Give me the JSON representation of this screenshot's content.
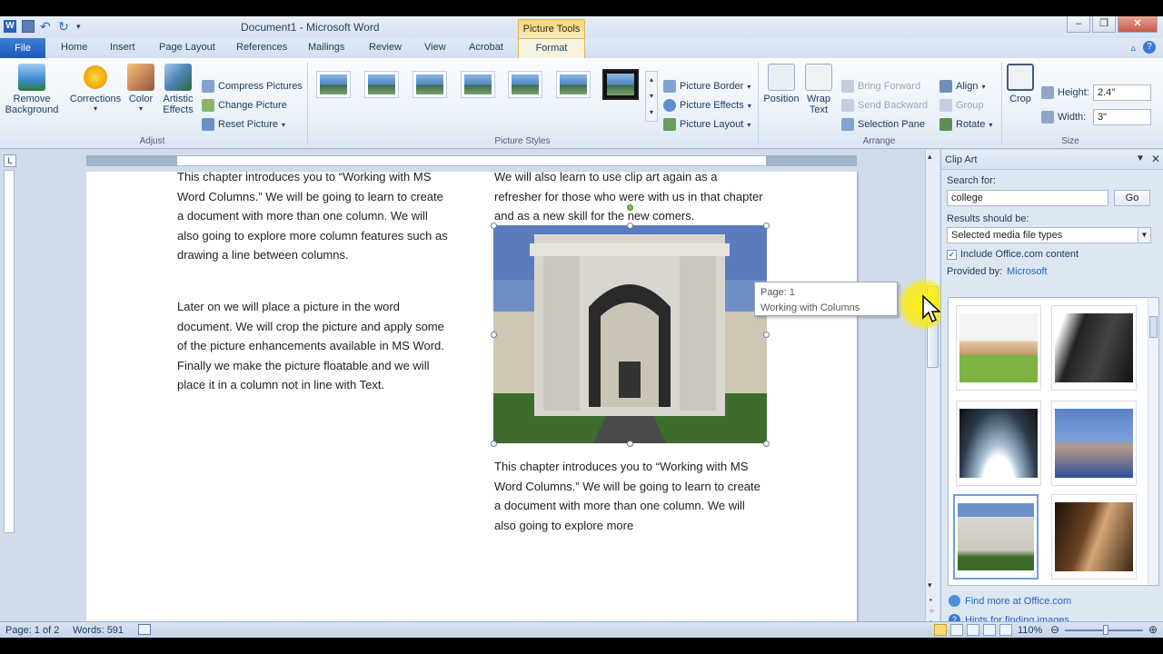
{
  "window": {
    "title": "Document1 - Microsoft Word",
    "context_tab": "Picture Tools"
  },
  "tabs": [
    {
      "label": "File"
    },
    {
      "label": "Home"
    },
    {
      "label": "Insert"
    },
    {
      "label": "Page Layout"
    },
    {
      "label": "References"
    },
    {
      "label": "Mailings"
    },
    {
      "label": "Review"
    },
    {
      "label": "View"
    },
    {
      "label": "Acrobat"
    },
    {
      "label": "Format"
    }
  ],
  "ribbon": {
    "adjust": {
      "remove_bg": "Remove\nBackground",
      "corrections": "Corrections",
      "color": "Color",
      "artistic": "Artistic\nEffects",
      "compress": "Compress Pictures",
      "change": "Change Picture",
      "reset": "Reset Picture",
      "group": "Adjust"
    },
    "styles": {
      "border": "Picture Border",
      "effects": "Picture Effects",
      "layout": "Picture Layout",
      "group": "Picture Styles"
    },
    "arrange": {
      "position": "Position",
      "wrap": "Wrap\nText",
      "bring_forward": "Bring Forward",
      "send_backward": "Send Backward",
      "selection_pane": "Selection Pane",
      "align": "Align",
      "group_btn": "Group",
      "rotate": "Rotate",
      "group": "Arrange"
    },
    "size": {
      "crop": "Crop",
      "height_label": "Height:",
      "height": "2.4\"",
      "width_label": "Width:",
      "width": "3\"",
      "group": "Size"
    }
  },
  "document": {
    "left_para1": "This chapter introduces you to “Working with MS Word Columns.” We will be going to learn to create a document with more than one column. We will also going to explore more column features such as drawing a line between columns.",
    "left_para2": "Later on we will place a picture in the word document. We will crop the picture and apply some of the picture enhancements available in MS Word. Finally we make the picture floatable and we will place it in a column not in line with Text.",
    "right_para1": "We will also learn to use clip art again as a refresher for those who were with us in that chapter and as a new skill for the new comers.",
    "right_para2": "This chapter introduces you to “Working with MS Word Columns.” We will be going to learn to create a document with more than one column. We will also going to explore more"
  },
  "tooltip": {
    "line1": "Page: 1",
    "line2": "Working with Columns"
  },
  "clipart": {
    "title": "Clip Art",
    "search_label": "Search for:",
    "search_value": "college",
    "go": "Go",
    "results_label": "Results should be:",
    "results_value": "Selected media file types",
    "include_office": "Include Office.com content",
    "provided_label": "Provided by:",
    "provider": "Microsoft",
    "find_more": "Find more at Office.com",
    "hints": "Hints for finding images"
  },
  "status": {
    "page": "Page: 1 of 2",
    "words": "Words: 591",
    "zoom": "110%"
  }
}
